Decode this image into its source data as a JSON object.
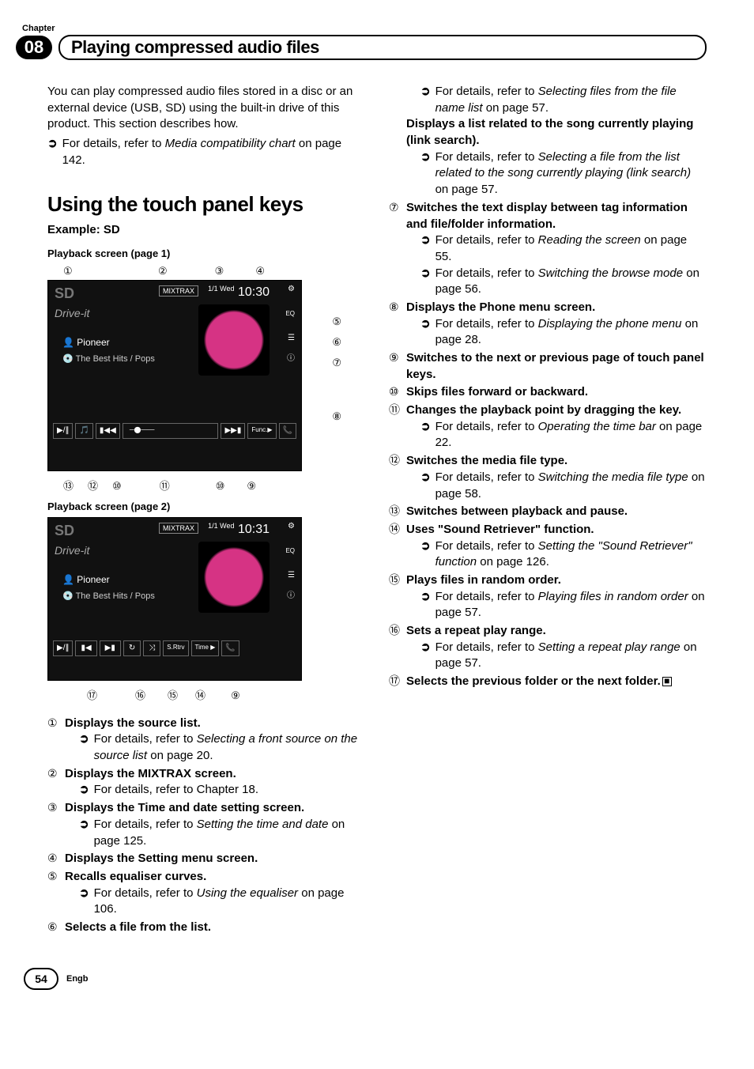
{
  "chapter": {
    "label": "Chapter",
    "number": "08",
    "title": "Playing compressed audio files"
  },
  "intro": {
    "text": "You can play compressed audio files stored in a disc or an external device (USB, SD) using the built-in drive of this product. This section describes how.",
    "ref_prefix": "For details, refer to ",
    "ref_italic": "Media compatibility chart",
    "ref_suffix": " on page 142."
  },
  "heading": "Using the touch panel keys",
  "subheading": "Example: SD",
  "caption1": "Playback screen (page 1)",
  "caption2": "Playback screen (page 2)",
  "ss": {
    "time1": "10:30",
    "time1_frac": "1/1 Wed",
    "time2": "10:31",
    "time2_frac": "1/1 Wed",
    "logo": "SD",
    "drive": "Drive-it",
    "artist": "Pioneer",
    "track": "The Best Hits / Pops",
    "mixtrax": "MIXTRAX",
    "eq": "EQ"
  },
  "callouts_top1": {
    "a": "①",
    "b": "②",
    "c": "③",
    "d": "④"
  },
  "callouts_right1": {
    "e": "⑤",
    "f": "⑥",
    "g": "⑦",
    "h": "⑧"
  },
  "callouts_bottom1": {
    "m": "⑬",
    "l": "⑫",
    "j": "⑩",
    "k": "⑪",
    "j2": "⑩",
    "i": "⑨"
  },
  "callouts_bottom2": {
    "q": "⑰",
    "p": "⑯",
    "o": "⑮",
    "n": "⑭",
    "i": "⑨"
  },
  "left_items": {
    "1": {
      "title": "Displays the source list.",
      "sub_prefix": "For details, refer to ",
      "sub_italic": "Selecting a front source on the source list",
      "sub_suffix": " on page 20."
    },
    "2": {
      "title": "Displays the MIXTRAX screen.",
      "sub_plain": "For details, refer to Chapter 18."
    },
    "3": {
      "title": "Displays the Time and date setting screen.",
      "sub_prefix": "For details, refer to ",
      "sub_italic": "Setting the time and date",
      "sub_suffix": " on page 125."
    },
    "4": {
      "title": "Displays the Setting menu screen."
    },
    "5": {
      "title": "Recalls equaliser curves.",
      "sub_prefix": "For details, refer to ",
      "sub_italic": "Using the equaliser",
      "sub_suffix": " on page 106."
    },
    "6": {
      "title": "Selects a file from the list."
    }
  },
  "right_lead": {
    "sub_prefix": "For details, refer to ",
    "sub_italic": "Selecting files from the file name list",
    "sub_suffix": " on page 57.",
    "title2": "Displays a list related to the song currently playing (link search).",
    "sub2_prefix": "For details, refer to ",
    "sub2_italic": "Selecting a file from the list related to the song currently playing (link search)",
    "sub2_suffix": " on page 57."
  },
  "right_items": {
    "7": {
      "title": "Switches the text display between tag information and file/folder information.",
      "sub1_prefix": "For details, refer to ",
      "sub1_italic": "Reading the screen",
      "sub1_suffix": " on page 55.",
      "sub2_prefix": "For details, refer to ",
      "sub2_italic": "Switching the browse mode",
      "sub2_suffix": " on page 56."
    },
    "8": {
      "title": "Displays the Phone menu screen.",
      "sub_prefix": "For details, refer to ",
      "sub_italic": "Displaying the phone menu",
      "sub_suffix": " on page 28."
    },
    "9": {
      "title": "Switches to the next or previous page of touch panel keys."
    },
    "10": {
      "title": "Skips files forward or backward."
    },
    "11": {
      "title": "Changes the playback point by dragging the key.",
      "sub_prefix": "For details, refer to ",
      "sub_italic": "Operating the time bar",
      "sub_suffix": " on page 22."
    },
    "12": {
      "title": "Switches the media file type.",
      "sub_prefix": "For details, refer to ",
      "sub_italic": "Switching the media file type",
      "sub_suffix": " on page 58."
    },
    "13": {
      "title": "Switches between playback and pause."
    },
    "14": {
      "title": "Uses \"Sound Retriever\" function.",
      "sub_prefix": "For details, refer to ",
      "sub_italic": "Setting the \"Sound Retriever\" function",
      "sub_suffix": " on page 126."
    },
    "15": {
      "title": "Plays files in random order.",
      "sub_prefix": "For details, refer to ",
      "sub_italic": "Playing files in random order",
      "sub_suffix": " on page 57."
    },
    "16": {
      "title": "Sets a repeat play range.",
      "sub_prefix": "For details, refer to ",
      "sub_italic": "Setting a repeat play range",
      "sub_suffix": " on page 57."
    },
    "17": {
      "title": "Selects the previous folder or the next folder."
    }
  },
  "nums": {
    "1": "①",
    "2": "②",
    "3": "③",
    "4": "④",
    "5": "⑤",
    "6": "⑥",
    "7": "⑦",
    "8": "⑧",
    "9": "⑨",
    "10": "⑩",
    "11": "⑪",
    "12": "⑫",
    "13": "⑬",
    "14": "⑭",
    "15": "⑮",
    "16": "⑯",
    "17": "⑰"
  },
  "arrow": "➲",
  "end_mark": "■",
  "footer": {
    "page": "54",
    "lang": "Engb"
  }
}
